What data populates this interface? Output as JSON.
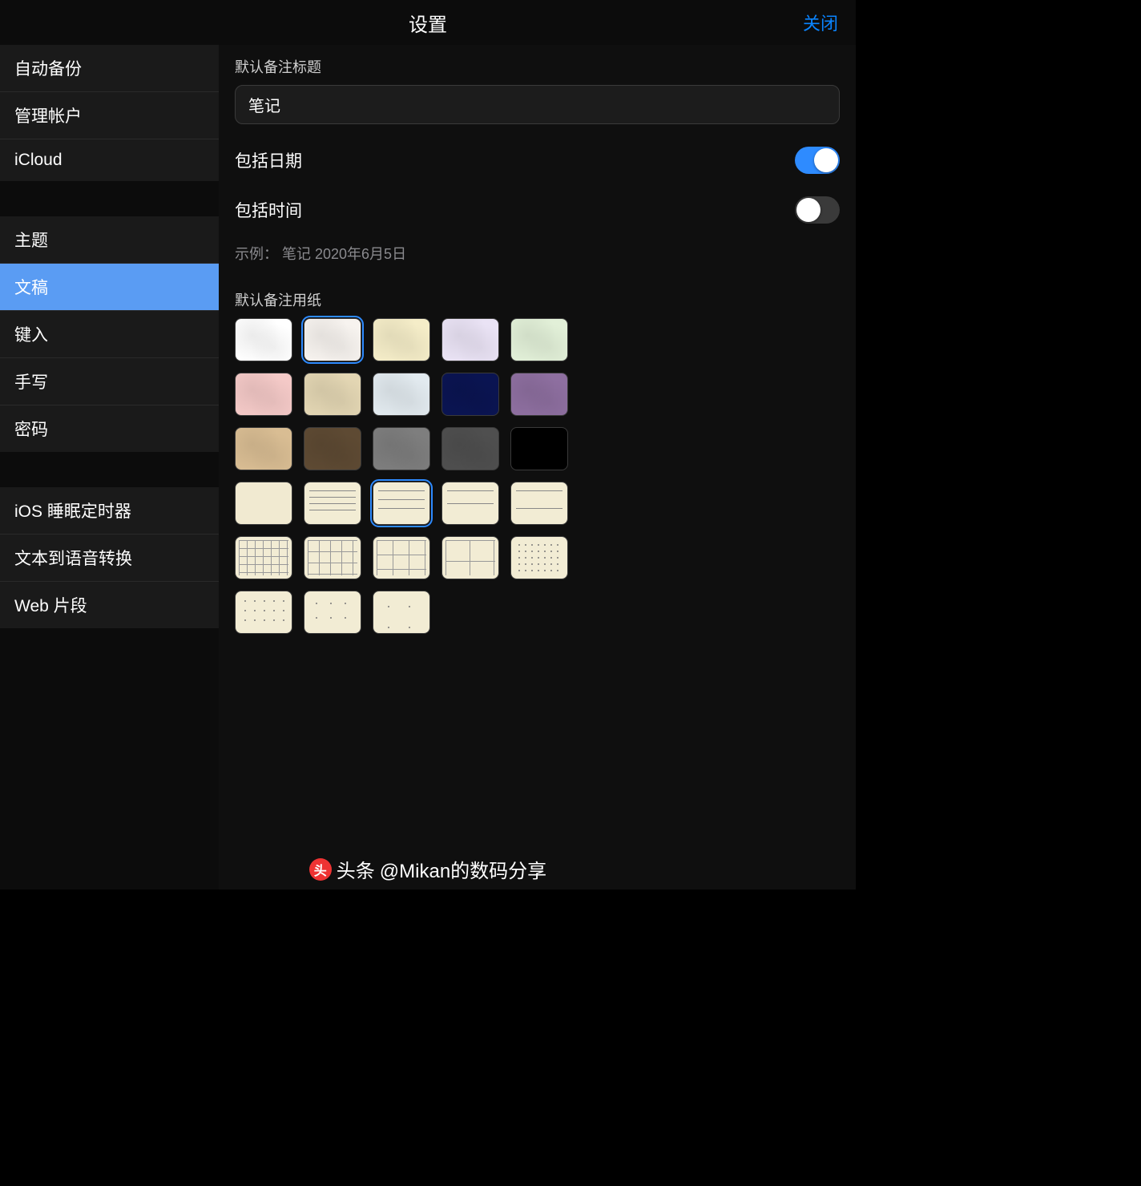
{
  "header": {
    "title": "设置",
    "close": "关闭"
  },
  "sidebar": {
    "group1": [
      {
        "key": "backup",
        "label": "自动备份"
      },
      {
        "key": "account",
        "label": "管理帐户"
      },
      {
        "key": "icloud",
        "label": "iCloud"
      }
    ],
    "group2": [
      {
        "key": "theme",
        "label": "主题"
      },
      {
        "key": "document",
        "label": "文稿",
        "active": true
      },
      {
        "key": "typing",
        "label": "键入"
      },
      {
        "key": "handwriting",
        "label": "手写"
      },
      {
        "key": "password",
        "label": "密码"
      }
    ],
    "group3": [
      {
        "key": "sleeptimer",
        "label": "iOS 睡眠定时器"
      },
      {
        "key": "tts",
        "label": "文本到语音转换"
      },
      {
        "key": "web",
        "label": "Web 片段"
      }
    ]
  },
  "content": {
    "titleSection": "默认备注标题",
    "titleValue": "笔记",
    "includeDate": {
      "label": "包括日期",
      "value": true
    },
    "includeTime": {
      "label": "包括时间",
      "value": false
    },
    "example": "示例： 笔记 2020年6月5日",
    "paperSection": "默认备注用纸",
    "colorSwatches": [
      {
        "id": "white",
        "bg": "#ffffff"
      },
      {
        "id": "offwhite",
        "bg": "#f7f3ef",
        "selected": true
      },
      {
        "id": "cream",
        "bg": "#f5edc8"
      },
      {
        "id": "lavender",
        "bg": "#eae3f5"
      },
      {
        "id": "mint",
        "bg": "#e2f0d8"
      },
      {
        "id": "pink",
        "bg": "#f4c9c7"
      },
      {
        "id": "tan",
        "bg": "#e3d6b3"
      },
      {
        "id": "sky",
        "bg": "#e2eaef"
      },
      {
        "id": "navy",
        "bg": "#0a1452"
      },
      {
        "id": "purple",
        "bg": "#8e6fa0"
      },
      {
        "id": "sand",
        "bg": "#d9bd93"
      },
      {
        "id": "brown",
        "bg": "#5e4a33"
      },
      {
        "id": "gray",
        "bg": "#7e7e7e"
      },
      {
        "id": "charcoal",
        "bg": "#4f4f4f"
      },
      {
        "id": "black",
        "bg": "#000000"
      }
    ],
    "patternSwatches": [
      {
        "id": "plain",
        "cls": "",
        "bg": "#f1ead1"
      },
      {
        "id": "lines-s",
        "cls": "lines lines-s",
        "bg": "#f2ecd4"
      },
      {
        "id": "lines-m",
        "cls": "lines lines-m",
        "bg": "#f2ecd4",
        "selected": true
      },
      {
        "id": "lines-l",
        "cls": "lines lines-l",
        "bg": "#f2ecd4"
      },
      {
        "id": "lines-xl",
        "cls": "lines lines-xl",
        "bg": "#f2ecd4"
      },
      {
        "id": "grid-s",
        "cls": "grid-pat grid-s",
        "bg": "#f2ecd4"
      },
      {
        "id": "grid-m",
        "cls": "grid-pat grid-m",
        "bg": "#f2ecd4"
      },
      {
        "id": "grid-l",
        "cls": "grid-pat grid-l",
        "bg": "#f2ecd4"
      },
      {
        "id": "grid-xl",
        "cls": "grid-pat grid-xl",
        "bg": "#f2ecd4"
      },
      {
        "id": "dots-s",
        "cls": "dots dots-s",
        "bg": "#f2ecd4"
      },
      {
        "id": "dots-m",
        "cls": "dots dots-m",
        "bg": "#f2ecd4"
      },
      {
        "id": "dots-l",
        "cls": "dots dots-l",
        "bg": "#f2ecd4"
      },
      {
        "id": "dots-xl",
        "cls": "dots dots-xl",
        "bg": "#f2ecd4"
      }
    ]
  },
  "watermark": {
    "logo": "头",
    "prefix": "头条",
    "text": "@Mikan的数码分享"
  }
}
